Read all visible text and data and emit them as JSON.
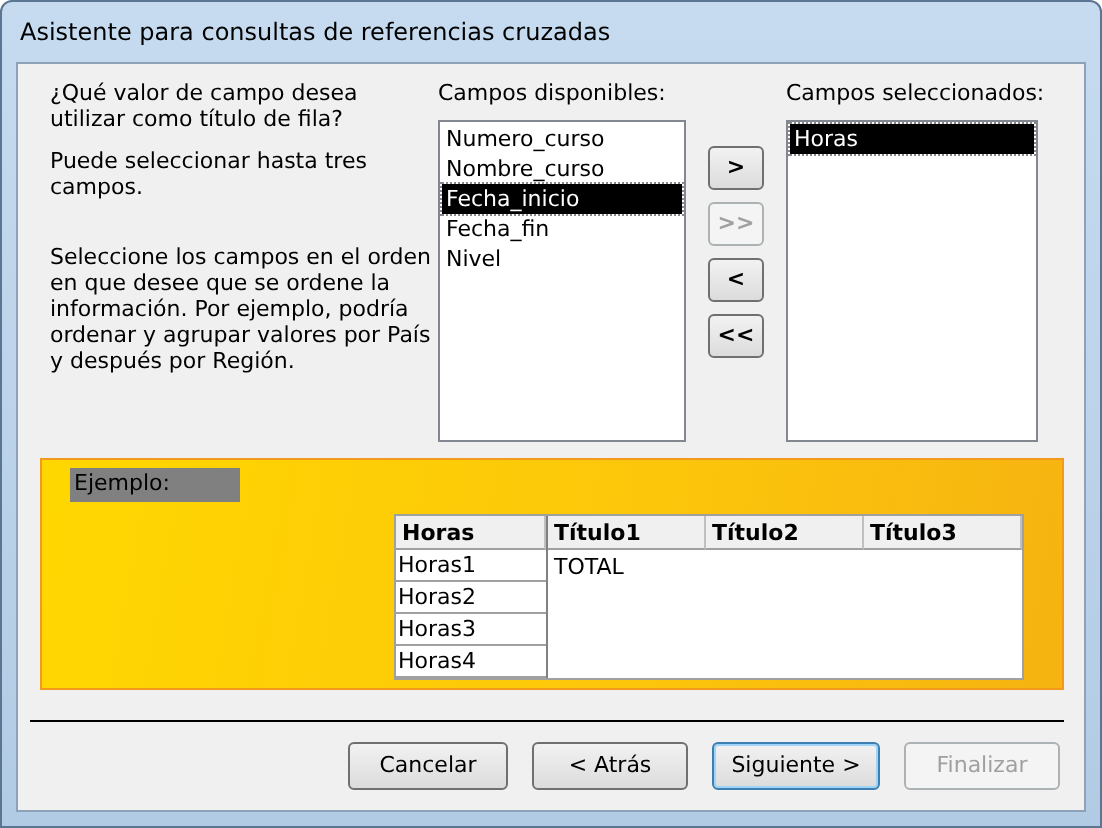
{
  "window": {
    "title": "Asistente para consultas de referencias cruzadas"
  },
  "instructions": [
    "¿Qué valor de campo desea utilizar como título de fila?",
    "Puede seleccionar hasta tres campos.",
    "Seleccione los campos en el orden en que desee que se ordene la información. Por ejemplo, podría ordenar y agrupar valores por País y después por Región."
  ],
  "available_fields": {
    "label": "Campos disponibles:",
    "items": [
      {
        "text": "Numero_curso",
        "selected": false
      },
      {
        "text": "Nombre_curso",
        "selected": false
      },
      {
        "text": "Fecha_inicio",
        "selected": true
      },
      {
        "text": "Fecha_fin",
        "selected": false
      },
      {
        "text": "Nivel",
        "selected": false
      }
    ]
  },
  "move_buttons": [
    {
      "label": ">",
      "disabled": false
    },
    {
      "label": ">>",
      "disabled": true
    },
    {
      "label": "<",
      "disabled": false
    },
    {
      "label": "<<",
      "disabled": false
    }
  ],
  "selected_fields": {
    "label": "Campos seleccionados:",
    "items": [
      {
        "text": "Horas",
        "selected": true
      }
    ]
  },
  "example": {
    "label": "Ejemplo:",
    "row_header": "Horas",
    "columns": [
      "Título1",
      "Título2",
      "Título3"
    ],
    "row_labels": [
      "Horas1",
      "Horas2",
      "Horas3",
      "Horas4"
    ],
    "total": "TOTAL"
  },
  "buttons": [
    {
      "label": "Cancelar",
      "disabled": false,
      "default": false
    },
    {
      "label": "< Atrás",
      "disabled": false,
      "default": false
    },
    {
      "label": "Siguiente >",
      "disabled": false,
      "default": true
    },
    {
      "label": "Finalizar",
      "disabled": true,
      "default": false
    }
  ]
}
